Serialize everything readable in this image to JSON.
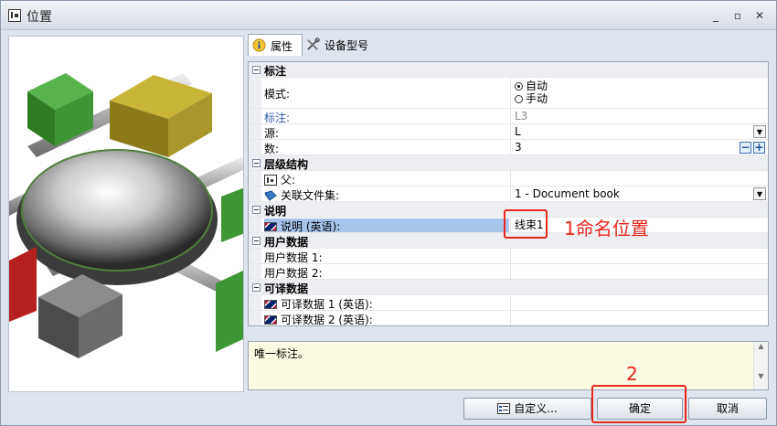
{
  "window": {
    "title": "位置"
  },
  "tabs": [
    {
      "label": "属性",
      "icon": "info-icon"
    },
    {
      "label": "设备型号",
      "icon": "tools-icon"
    }
  ],
  "properties": {
    "cat_label": {
      "title": "标注"
    },
    "mode": {
      "label": "模式:",
      "options": [
        "自动",
        "手动"
      ],
      "selected": "自动"
    },
    "label": {
      "label": "标注:",
      "value": "L3"
    },
    "source": {
      "label": "源:",
      "value": "L"
    },
    "count": {
      "label": "数:",
      "value": "3",
      "minus": "−",
      "plus": "+"
    },
    "cat_hierarchy": {
      "title": "层级结构"
    },
    "parent": {
      "label": "父:",
      "value": ""
    },
    "docset": {
      "label": "关联文件集:",
      "value": "1 - Document book"
    },
    "cat_description": {
      "title": "说明"
    },
    "description_en": {
      "label": "说明 (英语):",
      "value": "线束1"
    },
    "cat_userdata": {
      "title": "用户数据"
    },
    "userdata1": {
      "label": "用户数据 1:",
      "value": ""
    },
    "userdata2": {
      "label": "用户数据 2:",
      "value": ""
    },
    "cat_transdata": {
      "title": "可译数据"
    },
    "transdata1": {
      "label": "可译数据 1 (英语):",
      "value": ""
    },
    "transdata2": {
      "label": "可译数据 2 (英语):",
      "value": ""
    }
  },
  "description_panel": {
    "text": "唯一标注。"
  },
  "buttons": {
    "customize": "自定义...",
    "ok": "确定",
    "cancel": "取消"
  },
  "annotations": {
    "step1": "1命名位置",
    "step2": "2"
  },
  "colors": {
    "annotation": "#e8261c",
    "selection": "#a9c4ea",
    "link": "#2c59a8"
  }
}
